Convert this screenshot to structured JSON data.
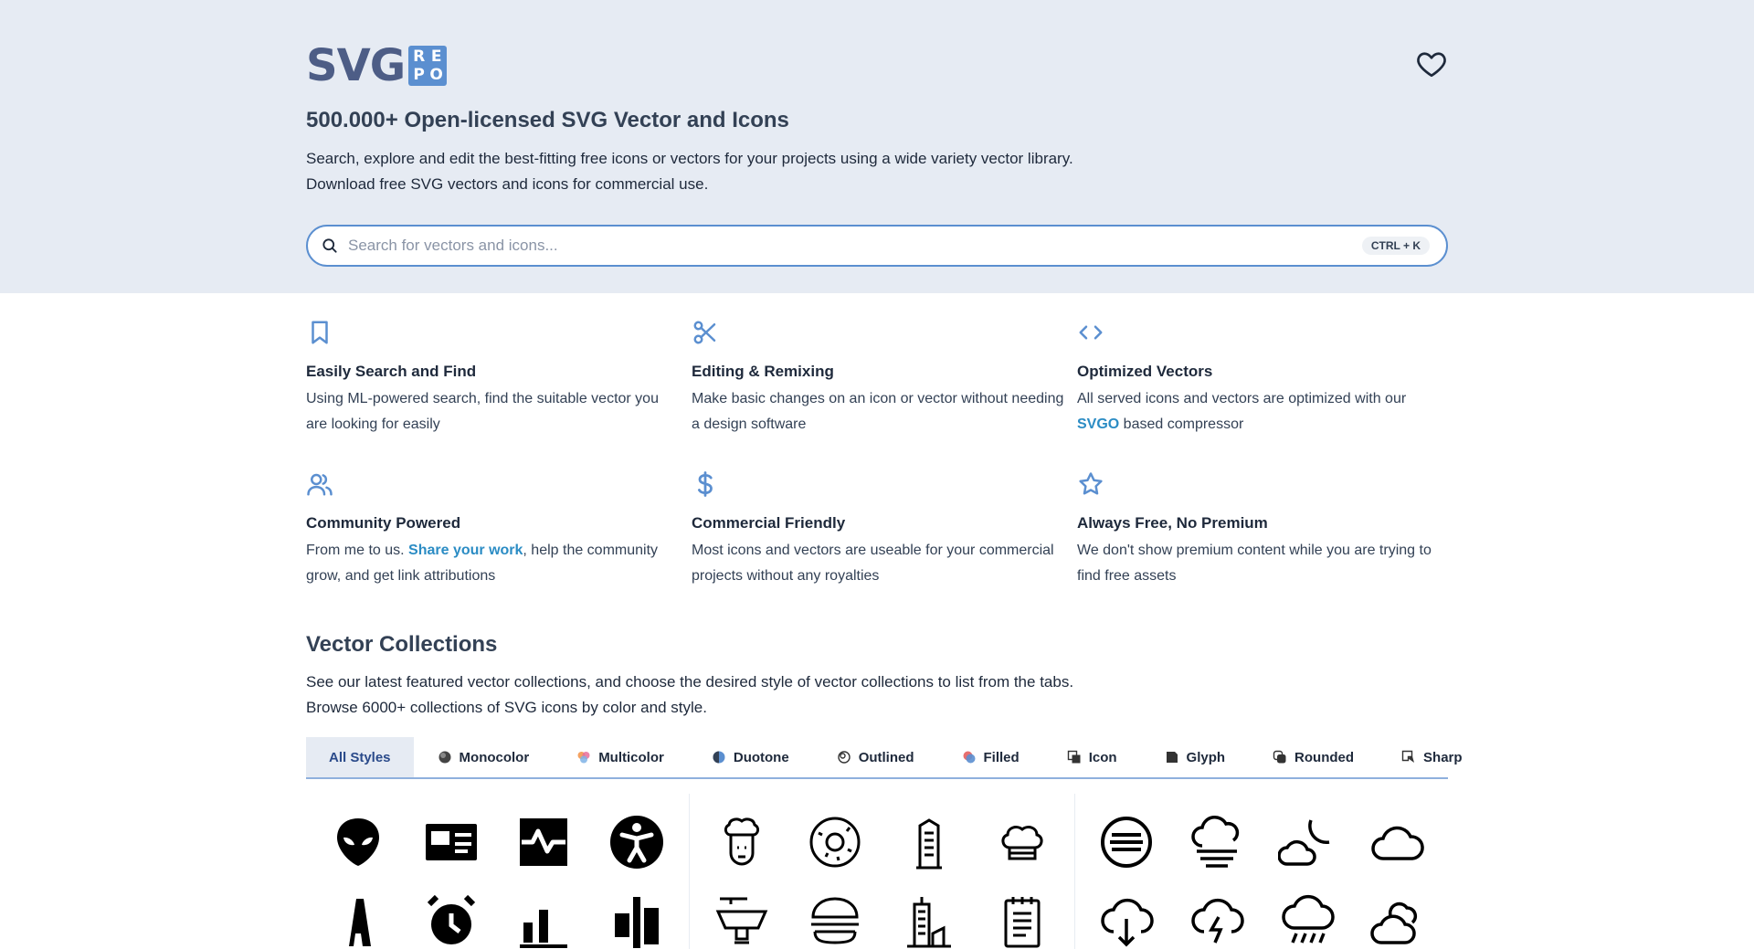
{
  "header": {
    "logo_text": "SVG",
    "logo_badge": [
      "R",
      "E",
      "P",
      "O"
    ],
    "favorites_icon": "heart-icon"
  },
  "hero": {
    "title": "500.000+ Open-licensed SVG Vector and Icons",
    "description_line1": "Search, explore and edit the best-fitting free icons or vectors for your projects using a wide variety vector library.",
    "description_line2": "Download free SVG vectors and icons for commercial use."
  },
  "search": {
    "placeholder": "Search for vectors and icons...",
    "value": "",
    "shortcut": "CTRL + K"
  },
  "features": [
    {
      "icon": "bookmark-icon",
      "title": "Easily Search and Find",
      "text": "Using ML-powered search, find the suitable vector you are looking for easily"
    },
    {
      "icon": "scissors-icon",
      "title": "Editing & Remixing",
      "text": "Make basic changes on an icon or vector without needing a design software"
    },
    {
      "icon": "code-icon",
      "title": "Optimized Vectors",
      "text_before": "All served icons and vectors are optimized with our ",
      "link": "SVGO",
      "text_after": " based compressor"
    },
    {
      "icon": "users-icon",
      "title": "Community Powered",
      "text_before": "From me to us. ",
      "link": "Share your work",
      "text_after": ", help the community grow, and get link attributions"
    },
    {
      "icon": "dollar-icon",
      "title": "Commercial Friendly",
      "text": "Most icons and vectors are useable for your commercial projects without any royalties"
    },
    {
      "icon": "star-icon",
      "title": "Always Free, No Premium",
      "text": "We don't show premium content while you are trying to find free assets"
    }
  ],
  "collections": {
    "title": "Vector Collections",
    "description_line1": "See our latest featured vector collections, and choose the desired style of vector collections to list from the tabs.",
    "description_line2": "Browse 6000+ collections of SVG icons by color and style.",
    "tabs": [
      {
        "label": "All Styles",
        "active": true
      },
      {
        "label": "Monocolor"
      },
      {
        "label": "Multicolor"
      },
      {
        "label": "Duotone"
      },
      {
        "label": "Outlined"
      },
      {
        "label": "Filled"
      },
      {
        "label": "Icon"
      },
      {
        "label": "Glyph"
      },
      {
        "label": "Rounded"
      },
      {
        "label": "Sharp"
      }
    ],
    "panels": [
      [
        "alien-icon",
        "id-card-icon",
        "pulse-icon",
        "accessibility-icon",
        "letter-a-icon",
        "alarm-clock-icon",
        "bar-chart-icon",
        "align-center-icon"
      ],
      [
        "chef-icon",
        "donut-icon",
        "building-icon",
        "chef-hat-icon",
        "grill-icon",
        "burger-icon",
        "city-icon",
        "notepad-icon"
      ],
      [
        "fog-icon",
        "foggy-cloud-icon",
        "cloud-moon-icon",
        "cloud-icon",
        "cloud-download-icon",
        "thunder-cloud-icon",
        "rain-cloud-icon",
        "clouds-icon"
      ]
    ]
  },
  "colors": {
    "accent": "#5b8fd0",
    "hero_bg": "#e6ebf3",
    "link": "#2b8cc4",
    "logo": "#4d5d86"
  }
}
